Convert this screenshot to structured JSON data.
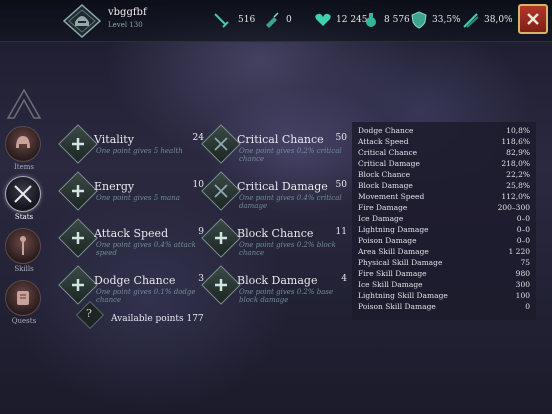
{
  "player": {
    "name": "vbggfbf",
    "level": "Level 130"
  },
  "resources": [
    {
      "icon": "sword-icon",
      "value": "516"
    },
    {
      "icon": "potion-icon",
      "value": "0"
    },
    {
      "icon": "heart-icon",
      "value": "12 245"
    },
    {
      "icon": "mana-flask-icon",
      "value": "8 576"
    },
    {
      "icon": "shield-icon",
      "value": "33,5%"
    },
    {
      "icon": "crossed-daggers-icon",
      "value": "38,0%"
    }
  ],
  "sidebar": {
    "items": [
      {
        "label": "Items",
        "icon": "helmet-icon",
        "active": false
      },
      {
        "label": "Stats",
        "icon": "crossed-swords-icon",
        "active": true
      },
      {
        "label": "Skills",
        "icon": "staff-icon",
        "active": false
      },
      {
        "label": "Quests",
        "icon": "scroll-icon",
        "active": false
      }
    ]
  },
  "skills": [
    {
      "name": "Vitality",
      "value": "24",
      "desc": "One point gives 5 health"
    },
    {
      "name": "Critical Chance",
      "value": "50",
      "desc": "One point gives 0.2% critical chance"
    },
    {
      "name": "Energy",
      "value": "10",
      "desc": "One point gives 5 mana"
    },
    {
      "name": "Critical Damage",
      "value": "50",
      "desc": "One point gives 0.4% critical damage"
    },
    {
      "name": "Attack Speed",
      "value": "9",
      "desc": "One point gives 0.4% attack speed"
    },
    {
      "name": "Block Chance",
      "value": "11",
      "desc": "One point gives 0.2% block chance"
    },
    {
      "name": "Dodge Chance",
      "value": "3",
      "desc": "One point gives 0.1% dodge chance"
    },
    {
      "name": "Block Damage",
      "value": "4",
      "desc": "One point gives 0.2% base block damage"
    }
  ],
  "available": {
    "text": "Available points 177",
    "icon": "question-mark-icon"
  },
  "stats": [
    {
      "label": "Dodge Chance",
      "value": "10,8%"
    },
    {
      "label": "Attack Speed",
      "value": "118,6%"
    },
    {
      "label": "Critical Chance",
      "value": "82,9%"
    },
    {
      "label": "Critical Damage",
      "value": "218,0%"
    },
    {
      "label": "Block Chance",
      "value": "22,2%"
    },
    {
      "label": "Block Damage",
      "value": "25,8%"
    },
    {
      "label": "Movement Speed",
      "value": "112,0%"
    },
    {
      "label": "Fire Damage",
      "value": "200–300"
    },
    {
      "label": "Ice Damage",
      "value": "0–0"
    },
    {
      "label": "Lightning Damage",
      "value": "0–0"
    },
    {
      "label": "Poison Damage",
      "value": "0–0"
    },
    {
      "label": "Area Skill Damage",
      "value": "1 220"
    },
    {
      "label": "Physical Skill Damage",
      "value": "75"
    },
    {
      "label": "Fire Skill Damage",
      "value": "980"
    },
    {
      "label": "Ice Skill Damage",
      "value": "300"
    },
    {
      "label": "Lightning Skill Damage",
      "value": "100"
    },
    {
      "label": "Poison Skill Damage",
      "value": "0"
    }
  ],
  "colors": {
    "accent": "#3fd0b0",
    "close": "#b3362b",
    "frame": "#d6b46a"
  }
}
